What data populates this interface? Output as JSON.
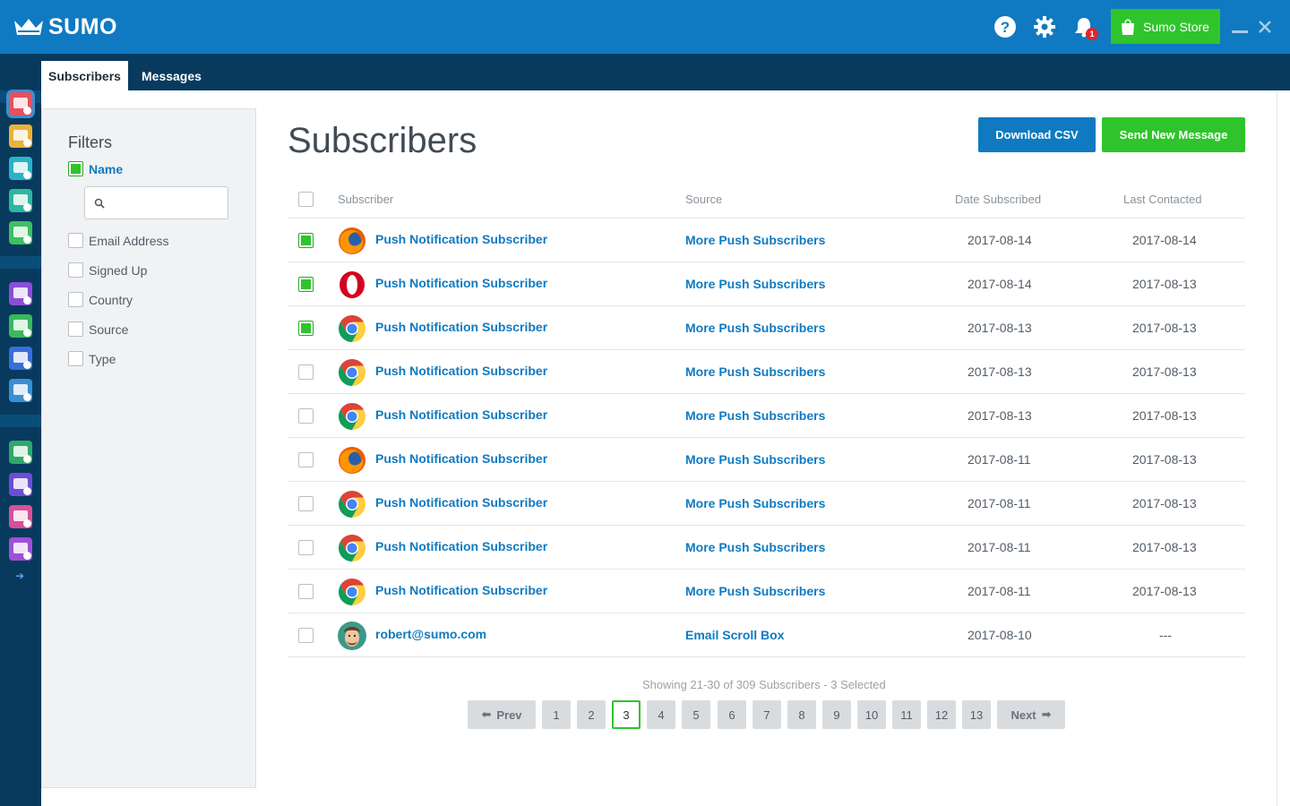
{
  "app": {
    "logo_text": "SUMO"
  },
  "header": {
    "notification_count": "1",
    "store_label": "Sumo Store"
  },
  "tabs": [
    {
      "label": "Subscribers",
      "active": true
    },
    {
      "label": "Messages",
      "active": false
    }
  ],
  "sidebar_apps": [
    {
      "name": "list-builder",
      "color": "#e8505b"
    },
    {
      "name": "smart-bar",
      "color": "#e9b23a"
    },
    {
      "name": "scroll-box",
      "color": "#2ab3c6"
    },
    {
      "name": "welcome-mat",
      "color": "#2fb6a0"
    },
    {
      "name": "contact-form",
      "color": "#3cc060"
    },
    {
      "name": "share",
      "color": "#8a4fd6"
    },
    {
      "name": "image-sharer",
      "color": "#39b95a"
    },
    {
      "name": "highlighter",
      "color": "#3a6ed6"
    },
    {
      "name": "content-analytics",
      "color": "#3a8fd1"
    },
    {
      "name": "google-analytics",
      "color": "#2fa86a"
    },
    {
      "name": "heat-maps",
      "color": "#6a4fd6"
    },
    {
      "name": "discover",
      "color": "#d94f9a"
    },
    {
      "name": "push-notifications",
      "color": "#a04fd6"
    }
  ],
  "filters": {
    "title": "Filters",
    "items": [
      {
        "label": "Name",
        "checked": true
      },
      {
        "label": "Email Address",
        "checked": false
      },
      {
        "label": "Signed Up",
        "checked": false
      },
      {
        "label": "Country",
        "checked": false
      },
      {
        "label": "Source",
        "checked": false
      },
      {
        "label": "Type",
        "checked": false
      }
    ],
    "search_value": ""
  },
  "page": {
    "title": "Subscribers"
  },
  "actions": {
    "download_csv": "Download CSV",
    "send_message": "Send New Message"
  },
  "table": {
    "headers": {
      "subscriber": "Subscriber",
      "source": "Source",
      "date_subscribed": "Date Subscribed",
      "last_contacted": "Last Contacted"
    },
    "rows": [
      {
        "checked": true,
        "browser": "firefox",
        "name": "Push Notification Subscriber",
        "source": "More Push Subscribers",
        "date_subscribed": "2017-08-14",
        "last_contacted": "2017-08-14"
      },
      {
        "checked": true,
        "browser": "opera",
        "name": "Push Notification Subscriber",
        "source": "More Push Subscribers",
        "date_subscribed": "2017-08-14",
        "last_contacted": "2017-08-13"
      },
      {
        "checked": true,
        "browser": "chrome",
        "name": "Push Notification Subscriber",
        "source": "More Push Subscribers",
        "date_subscribed": "2017-08-13",
        "last_contacted": "2017-08-13"
      },
      {
        "checked": false,
        "browser": "chrome",
        "name": "Push Notification Subscriber",
        "source": "More Push Subscribers",
        "date_subscribed": "2017-08-13",
        "last_contacted": "2017-08-13"
      },
      {
        "checked": false,
        "browser": "chrome",
        "name": "Push Notification Subscriber",
        "source": "More Push Subscribers",
        "date_subscribed": "2017-08-13",
        "last_contacted": "2017-08-13"
      },
      {
        "checked": false,
        "browser": "firefox",
        "name": "Push Notification Subscriber",
        "source": "More Push Subscribers",
        "date_subscribed": "2017-08-11",
        "last_contacted": "2017-08-13"
      },
      {
        "checked": false,
        "browser": "chrome",
        "name": "Push Notification Subscriber",
        "source": "More Push Subscribers",
        "date_subscribed": "2017-08-11",
        "last_contacted": "2017-08-13"
      },
      {
        "checked": false,
        "browser": "chrome",
        "name": "Push Notification Subscriber",
        "source": "More Push Subscribers",
        "date_subscribed": "2017-08-11",
        "last_contacted": "2017-08-13"
      },
      {
        "checked": false,
        "browser": "chrome",
        "name": "Push Notification Subscriber",
        "source": "More Push Subscribers",
        "date_subscribed": "2017-08-11",
        "last_contacted": "2017-08-13"
      },
      {
        "checked": false,
        "browser": "avatar",
        "name": "robert@sumo.com",
        "source": "Email Scroll Box",
        "date_subscribed": "2017-08-10",
        "last_contacted": "---"
      }
    ]
  },
  "pagination": {
    "summary": "Showing 21-30 of 309 Subscribers - 3 Selected",
    "prev": "Prev",
    "next": "Next",
    "pages": [
      "1",
      "2",
      "3",
      "4",
      "5",
      "6",
      "7",
      "8",
      "9",
      "10",
      "11",
      "12",
      "13"
    ],
    "current": "3"
  },
  "colors": {
    "brand_blue": "#0f7ac1",
    "nav_dark": "#083a5e",
    "green": "#2fc42c"
  }
}
